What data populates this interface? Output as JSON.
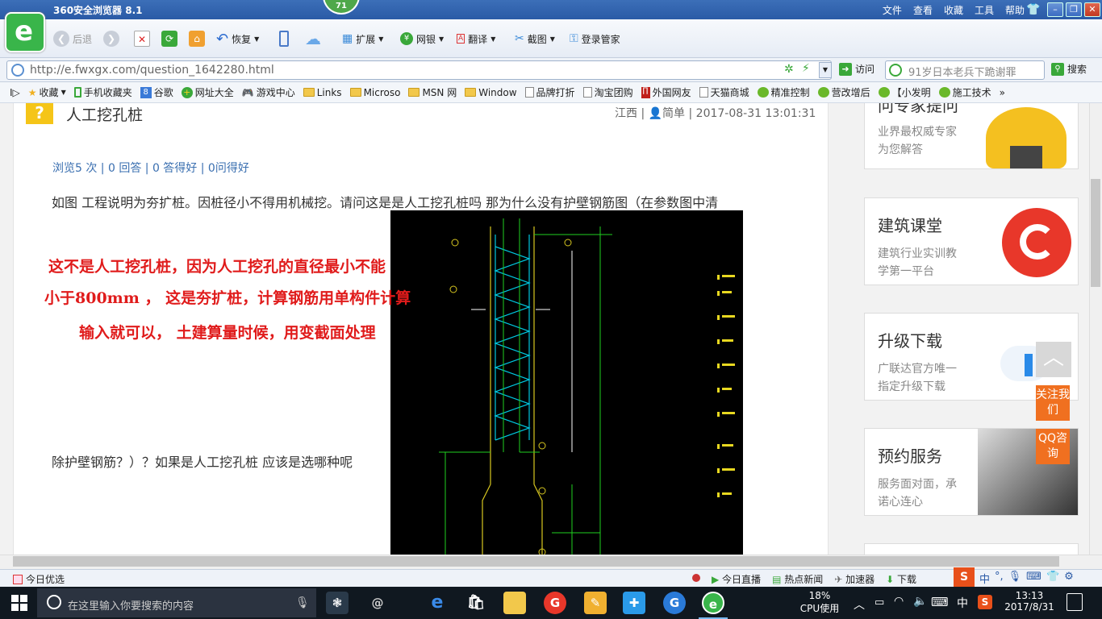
{
  "window": {
    "title": "360安全浏览器 8.1",
    "badge": "71",
    "menu": [
      "文件",
      "查看",
      "收藏",
      "工具",
      "帮助"
    ]
  },
  "toolbar": {
    "back": "后退",
    "restore": "恢复",
    "extend": "扩展",
    "netbank": "网银",
    "translate": "翻译",
    "screenshot": "截图",
    "login_manager": "登录管家"
  },
  "address": {
    "url": "http://e.fwxgx.com/question_1642280.html",
    "visit": "访问",
    "search_placeholder": "91岁日本老兵下跪谢罪",
    "search_button": "搜索"
  },
  "bookmarks": [
    "收藏",
    "手机收藏夹",
    "谷歌",
    "网址大全",
    "游戏中心",
    "Links",
    "Microso",
    "MSN 网",
    "Window",
    "品牌打折",
    "淘宝团购",
    "外国网友",
    "天猫商城",
    "精准控制",
    "营改增后",
    "【小发明",
    "施工技术"
  ],
  "question": {
    "icon": "?",
    "title": "人工挖孔桩",
    "meta": "江西 | 👤简单 | 2017-08-31 13:01:31",
    "stats": "浏览5 次 | 0 回答 | 0 答得好 | 0问得好",
    "body_line1": "如图 工程说明为夯扩桩。因桩径小不得用机械挖。请问这是是人工挖孔桩吗 那为什么没有护壁钢筋图（在参数图中清",
    "body_line2": "除护壁钢筋？）？如果是人工挖孔桩 应该是选哪种呢"
  },
  "answer_overlay": [
    "这不是人工挖孔桩，因为人工挖孔的直径最小不能",
    "小于800mm ， 这是夯扩桩，计算钢筋用单构件计算",
    "输入就可以， 土建算量时候，用变截面处理"
  ],
  "sidebar": [
    {
      "title": "问专家提问",
      "desc": [
        "业界最权威专家",
        "为您解答"
      ]
    },
    {
      "title": "建筑课堂",
      "desc": [
        "建筑行业实训教",
        "学第一平台"
      ]
    },
    {
      "title": "升级下载",
      "desc": [
        "广联达官方唯一",
        "指定升级下载"
      ]
    },
    {
      "title": "预约服务",
      "desc": [
        "服务面对面，承",
        "诺心连心"
      ]
    }
  ],
  "floating": {
    "to_top": "︿",
    "follow": "关注我们",
    "qq": "QQ咨询"
  },
  "statusbar": {
    "left": "今日优选",
    "items": [
      "今日直播",
      "热点新闻",
      "加速器",
      "下载"
    ],
    "ime": "中"
  },
  "taskbar": {
    "search_placeholder": "在这里输入你要搜索的内容",
    "cpu_percent": "18%",
    "cpu_label": "CPU使用",
    "ime": "中",
    "time": "13:13",
    "date": "2017/8/31"
  },
  "colors": {
    "accent_blue": "#2a5aa6",
    "answer_red": "#e01b1b",
    "orange": "#f07020"
  }
}
